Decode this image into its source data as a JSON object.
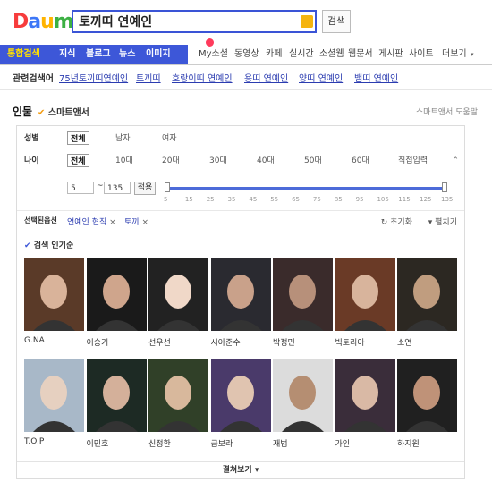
{
  "logo": {
    "text": "Daum",
    "colors": [
      "#f73c3c",
      "#3c77f7",
      "#ffb400",
      "#3cb043"
    ]
  },
  "search": {
    "value": "토끼띠 연예인",
    "button": "검색"
  },
  "tabs": [
    {
      "label": "통합검색",
      "active": true
    },
    {
      "label": "지식",
      "active": true
    },
    {
      "label": "블로그",
      "active": true
    },
    {
      "label": "뉴스",
      "active": true
    },
    {
      "label": "이미지",
      "active": true
    },
    {
      "label": "My소셜",
      "active": false
    },
    {
      "label": "동영상",
      "active": false
    },
    {
      "label": "카페",
      "active": false
    },
    {
      "label": "실시간",
      "active": false
    },
    {
      "label": "소셜웹",
      "active": false
    },
    {
      "label": "웹문서",
      "active": false
    },
    {
      "label": "게시판",
      "active": false
    },
    {
      "label": "사이트",
      "active": false
    },
    {
      "label": "더보기",
      "active": false
    }
  ],
  "related": {
    "label": "관련검색어",
    "links": [
      "75년토끼띠연예인",
      "토끼띠",
      "호랑이띠 연예인",
      "용띠 연예인",
      "양띠 연예인",
      "뱀띠 연예인"
    ]
  },
  "section": {
    "title": "인물",
    "smart": "스마트앤서",
    "help": "스마트앤서 도움말"
  },
  "filter": {
    "gender_label": "성별",
    "gender_options": [
      "전체",
      "남자",
      "여자"
    ],
    "age_label": "나이",
    "age_options": [
      "전체",
      "10대",
      "20대",
      "30대",
      "40대",
      "50대",
      "60대",
      "직접입력"
    ],
    "min": "5",
    "dash": "~",
    "max": "135",
    "apply": "적용",
    "ticks": [
      "5",
      "15",
      "25",
      "35",
      "45",
      "55",
      "65",
      "75",
      "85",
      "95",
      "105",
      "115",
      "125",
      "135"
    ],
    "selected_label": "선택된옵션",
    "chips": [
      "연예인 현직",
      "토끼"
    ],
    "reset": "초기화",
    "expand": "펼치기",
    "range_min_fraction": 0,
    "range_max_fraction": 1
  },
  "results": {
    "sort": "검색 인기순",
    "people": [
      {
        "name": "G.NA",
        "c1": "#5a3a28",
        "c2": "#d9b39a"
      },
      {
        "name": "이승기",
        "c1": "#1a1a1a",
        "c2": "#cfa58c"
      },
      {
        "name": "선우선",
        "c1": "#222222",
        "c2": "#f0d8c8"
      },
      {
        "name": "시아준수",
        "c1": "#2a2a30",
        "c2": "#c9a18a"
      },
      {
        "name": "박정민",
        "c1": "#3a2b2b",
        "c2": "#b7907a"
      },
      {
        "name": "빅토리아",
        "c1": "#6a3a26",
        "c2": "#d8b49c"
      },
      {
        "name": "소연",
        "c1": "#2c2822",
        "c2": "#c09d7f"
      },
      {
        "name": "T.O.P",
        "c1": "#a8b8c8",
        "c2": "#e6d0c0"
      },
      {
        "name": "이민호",
        "c1": "#1d2a24",
        "c2": "#d4b09a"
      },
      {
        "name": "신정환",
        "c1": "#304028",
        "c2": "#d8b89c"
      },
      {
        "name": "금보라",
        "c1": "#4a3a6a",
        "c2": "#e0c4b0"
      },
      {
        "name": "재범",
        "c1": "#dcdcdc",
        "c2": "#b58e72"
      },
      {
        "name": "가인",
        "c1": "#3a2d3a",
        "c2": "#d9b9a5"
      },
      {
        "name": "하지원",
        "c1": "#202020",
        "c2": "#bf9278"
      }
    ],
    "more": "결쳐보기"
  }
}
